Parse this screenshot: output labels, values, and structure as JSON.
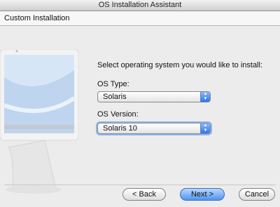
{
  "window": {
    "title": "OS Installation Assistant"
  },
  "header": {
    "title": "Custom Installation"
  },
  "main": {
    "prompt": "Select operating system you would like to install:",
    "os_type": {
      "label": "OS Type:",
      "value": "Solaris"
    },
    "os_version": {
      "label": "OS Version:",
      "value": "Solaris 10"
    }
  },
  "footer": {
    "back_label": "< Back",
    "next_label": "Next >",
    "cancel_label": "Cancel"
  },
  "icons": [
    "computer-illustration",
    "popup-arrows-icon"
  ]
}
